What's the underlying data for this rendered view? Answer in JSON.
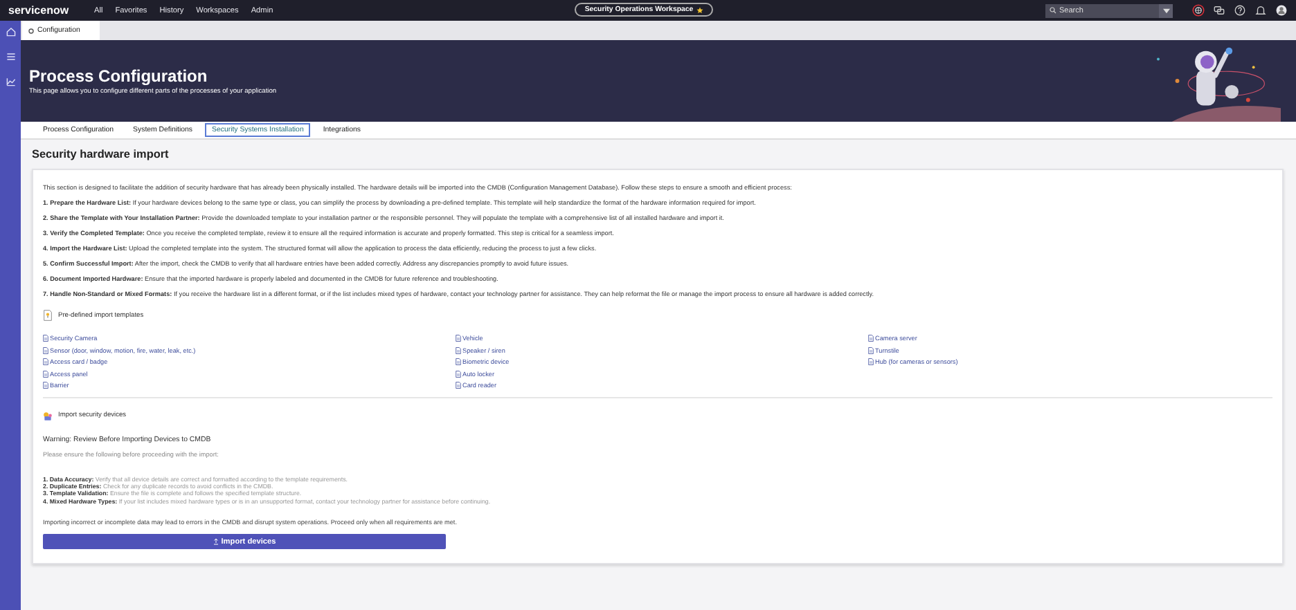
{
  "topbar": {
    "logo": "servicenow",
    "nav": [
      "All",
      "Favorites",
      "History",
      "Workspaces",
      "Admin"
    ],
    "workspace": {
      "label": "Security Operations Workspace",
      "starred": true
    },
    "search": {
      "placeholder": "Search"
    }
  },
  "page_tab": {
    "label": "Configuration"
  },
  "banner": {
    "title": "Process Configuration",
    "subtitle": "This page allows you to configure different parts of the processes of your application"
  },
  "tabs": [
    {
      "label": "Process Configuration",
      "selected": false
    },
    {
      "label": "System Definitions",
      "selected": false
    },
    {
      "label": "Security Systems Installation",
      "selected": true
    },
    {
      "label": "Integrations",
      "selected": false
    }
  ],
  "heading": "Security hardware import",
  "intro": "This section is designed to facilitate the addition of security hardware that has already been physically installed. The hardware details will be imported into the CMDB (Configuration Management Database). Follow these steps to ensure a smooth and efficient process:",
  "steps": [
    "**1. Prepare the Hardware List:** If your hardware devices belong to the same type or class, you can simplify the process by downloading a pre-defined template. This template will help standardize the format of the hardware information required for import.",
    "**2. Share the Template with Your Installation Partner:** Provide the downloaded template to your installation partner or the responsible personnel. They will populate the template with a comprehensive list of all installed hardware and import it.",
    "**3. Verify the Completed Template:** Once you receive the completed template, review it to ensure all the required information is accurate and properly formatted. This step is critical for a seamless import.",
    "**4. Import the Hardware List:** Upload the completed template into the system. The structured format will allow the application to process the data efficiently, reducing the process to just a few clicks.",
    "**5. Confirm Successful Import:** After the import, check the CMDB to verify that all hardware entries have been added correctly. Address any discrepancies promptly to avoid future issues.",
    "**6. Document Imported Hardware:** Ensure that the imported hardware is properly labeled and documented in the CMDB for future reference and troubleshooting.",
    "**7. Handle Non-Standard or Mixed Formats:** If you receive the hardware list in a different format, or if the list includes mixed types of hardware, contact your technology partner for assistance. They can help reformat the file or manage the import process to ensure all hardware is added correctly."
  ],
  "templates": {
    "title": "Pre-defined import templates",
    "columns": [
      [
        "Security Camera",
        "Sensor (door, window, motion, fire, water, leak, etc.)",
        "Access card / badge",
        "Access panel",
        "Barrier"
      ],
      [
        "Vehicle",
        "Speaker / siren",
        "Biometric device",
        "Auto locker",
        "Card reader"
      ],
      [
        "Camera server",
        "Turnstile",
        "Hub (for cameras or sensors)"
      ]
    ]
  },
  "import": {
    "title": "Import security devices",
    "warning": "Warning: Review Before Importing Devices to CMDB",
    "lead": "Please ensure the following before proceeding with the import:",
    "checks": [
      {
        "label": "1. Data Accuracy:",
        "text": "Verify that all device details are correct and formatted according to the template requirements."
      },
      {
        "label": "2. Duplicate Entries:",
        "text": "Check for any duplicate records to avoid conflicts in the CMDB."
      },
      {
        "label": "3. Template Validation:",
        "text": "Ensure the file is complete and follows the specified template structure."
      },
      {
        "label": "4. Mixed Hardware Types:",
        "text": "If your list includes mixed hardware types or is in an unsupported format, contact your technology partner for assistance before continuing."
      }
    ],
    "note": "Importing incorrect or incomplete data may lead to errors in the CMDB and disrupt system operations. Proceed only when all requirements are met.",
    "button": "Import devices"
  }
}
